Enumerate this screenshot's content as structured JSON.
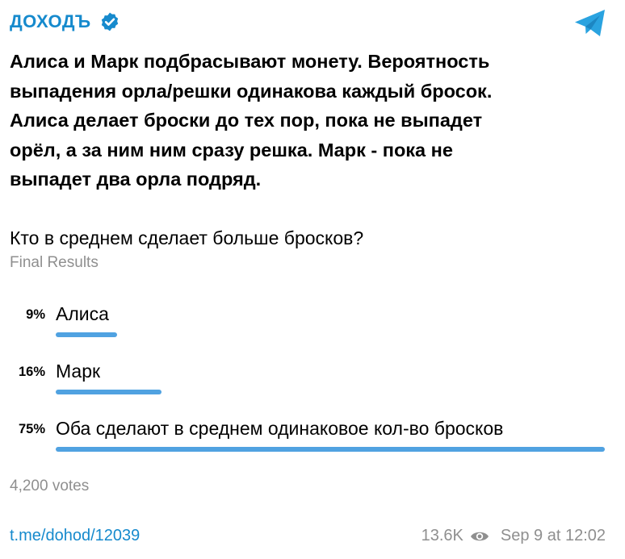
{
  "channel": {
    "name": "ДОХОДЪ",
    "verified_icon": "verified-badge-icon",
    "app_icon": "telegram-icon",
    "accent": "#168acd"
  },
  "post": {
    "text": "Алиса и Марк подбрасывают монету. Вероятность\nвыпадения орла/решки одинакова каждый бросок.\nАлиса делает броски до тех пор, пока не выпадет\norёл, а за ним ним сразу решка. Марк - пока не\nвыпадет два орла подряд."
  },
  "poll": {
    "question": "Кто в среднем сделает больше бросков?",
    "type_label": "Final Results",
    "bar_color": "#50a2e1",
    "options": [
      {
        "percent_label": "9%",
        "percent": 9,
        "label": "Алиса"
      },
      {
        "percent_label": "16%",
        "percent": 16,
        "label": "Марк"
      },
      {
        "percent_label": "75%",
        "percent": 75,
        "label": "Оба сделают в среднем одинаковое кол-во бросков"
      }
    ],
    "votes": "4,200 votes"
  },
  "footer": {
    "link": "t.me/dohod/12039",
    "views": "13.6K",
    "views_icon": "eye-icon",
    "date": "Sep 9 at 12:02"
  }
}
